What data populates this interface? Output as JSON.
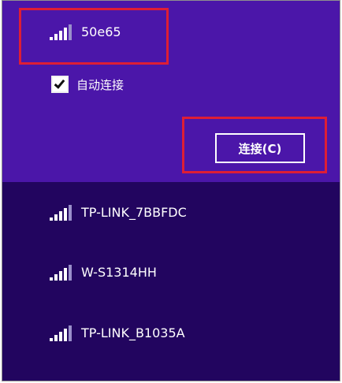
{
  "colors": {
    "selected_background": "#4b16a9",
    "list_background": "#22055f",
    "highlight_red": "#de1e35",
    "text": "#ffffff",
    "signal_bar_bright": "#ffffff",
    "signal_bar_dim": "#9a8fcb"
  },
  "selected_network": {
    "name": "50e65",
    "signal_icon": "wifi-signal-icon"
  },
  "auto_connect": {
    "label": "自动连接",
    "checked": true,
    "checkbox_icon": "checkmark-icon"
  },
  "connect_button": {
    "label": "连接(C)"
  },
  "networks": [
    {
      "name": "TP-LINK_7BBFDC",
      "signal_icon": "wifi-signal-icon"
    },
    {
      "name": "W-S1314HH",
      "signal_icon": "wifi-signal-icon"
    },
    {
      "name": "TP-LINK_B1035A",
      "signal_icon": "wifi-signal-icon"
    }
  ]
}
